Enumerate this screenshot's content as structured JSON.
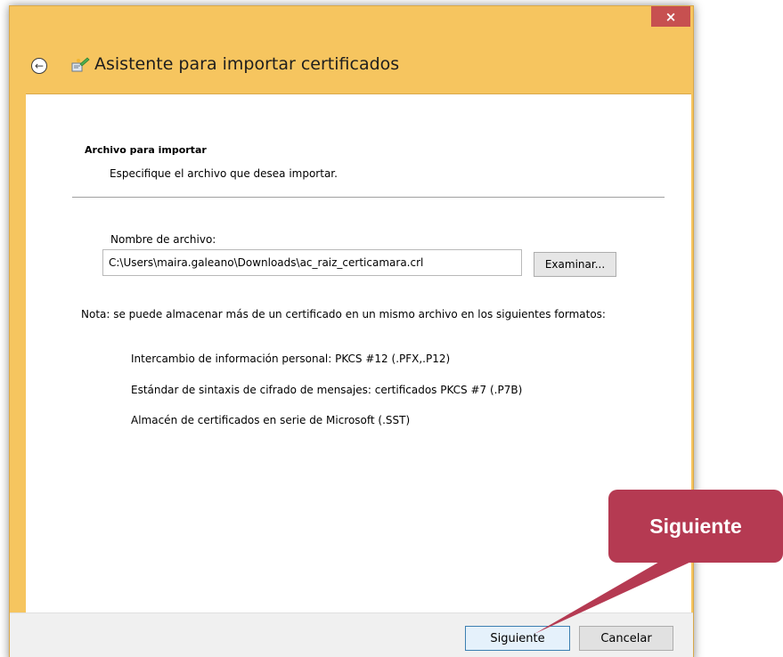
{
  "window": {
    "title": "Asistente para importar certificados",
    "close_label": "×",
    "chrome_color": "#f6c55f"
  },
  "page": {
    "section_title": "Archivo para importar",
    "section_desc": "Especifique el archivo que desea importar.",
    "file_label": "Nombre de archivo:",
    "file_value": "C:\\Users\\maira.galeano\\Downloads\\ac_raiz_certicamara.crl",
    "browse_label": "Examinar...",
    "note": "Nota: se puede almacenar más de un certificado en un mismo archivo en los siguientes formatos:",
    "formats": [
      "Intercambio de información personal: PKCS #12 (.PFX,.P12)",
      "Estándar de sintaxis de cifrado de mensajes: certificados PKCS #7 (.P7B)",
      "Almacén de certificados en serie de Microsoft (.SST)"
    ]
  },
  "footer": {
    "next_label": "Siguiente",
    "cancel_label": "Cancelar"
  },
  "callout": {
    "label": "Siguiente",
    "color": "#b53a52"
  },
  "icons": {
    "back": "back-arrow-icon",
    "wizard": "certificate-wizard-icon",
    "close": "close-icon"
  }
}
